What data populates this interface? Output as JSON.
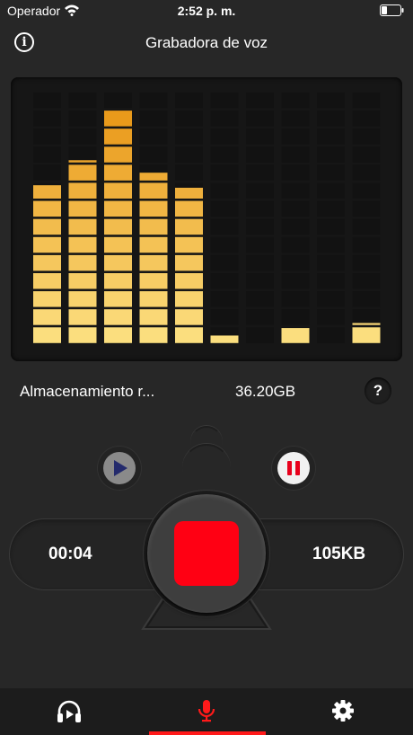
{
  "status_bar": {
    "carrier": "Operador",
    "time": "2:52 p. m."
  },
  "nav": {
    "info_label": "i",
    "title": "Grabadora de voz"
  },
  "vu_meter": {
    "columns": 10,
    "segments": 14,
    "levels": [
      0.63,
      0.73,
      0.93,
      0.68,
      0.62,
      0.03,
      0.0,
      0.06,
      0.0,
      0.08
    ],
    "colors": {
      "low": "#fbde7e",
      "high": "#e89413",
      "off": "#121212"
    }
  },
  "storage": {
    "label": "Almacenamiento r...",
    "value": "36.20GB",
    "help_label": "?"
  },
  "controls": {
    "elapsed": "00:04",
    "size": "105KB"
  },
  "tab_bar": {
    "tabs": [
      {
        "icon": "headphones-play-icon",
        "active": false
      },
      {
        "icon": "microphone-icon",
        "active": true
      },
      {
        "icon": "gear-icon",
        "active": false
      }
    ],
    "active_color": "#ff1a1a"
  },
  "colors": {
    "background": "#272727",
    "record": "#ff0013",
    "play_icon": "#232a6c",
    "pause_icon": "#e8001c"
  }
}
